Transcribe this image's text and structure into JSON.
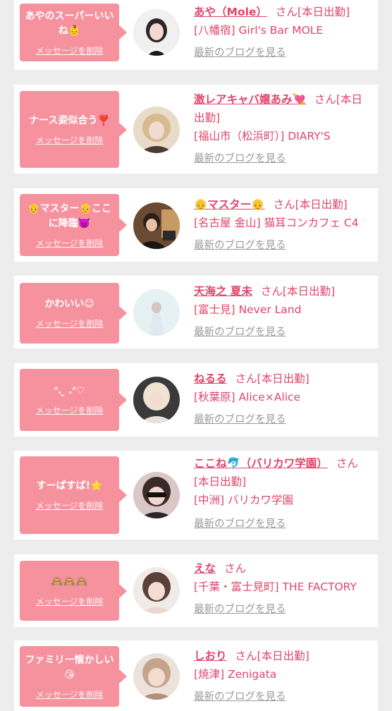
{
  "common": {
    "delete_label": "メッセージを削除",
    "blog_label": "最新のブログを見る",
    "san_label": "さん",
    "today_label": "[本日出勤]"
  },
  "entries": [
    {
      "message": "あやのスーパーいいね👶",
      "name": "あや（Mole）",
      "shop": "[八幡宿] Girl's Bar MOLE",
      "shift": true
    },
    {
      "message": "ナース姿似合う❣️",
      "name": "激レアキャバ嬢あみ💘",
      "shop": "[福山市（松浜町）] DIARY'S",
      "shift": true
    },
    {
      "message": "👴マスター👴ここに降臨👿",
      "name": "👴マスター👴",
      "shop": "[名古屋 金山] 猫耳コンカフェ C4",
      "shift": true
    },
    {
      "message": "かわいい☺",
      "name": "天海之 夏未",
      "shop": "[富士見] Never Land",
      "shift": true
    },
    {
      "message": "ᐢ. ̫ .ᐢ♡",
      "name": "ねるる",
      "shop": "[秋葉原] Alice×Alice",
      "shift": true
    },
    {
      "message": "すーぱすば!⭐",
      "name": "ここね🐬（バリカワ学園）",
      "shop": "[中洲] バリカワ学園",
      "shift": true
    },
    {
      "message": "🙈🙈🙈",
      "name": "えな",
      "shop": "[千葉・富士見町] THE FACTORY",
      "shift": false
    },
    {
      "message": "ファミリー懐かしい😘",
      "name": "しおり",
      "shop": "[焼津] Zenigata",
      "shift": true
    }
  ]
}
